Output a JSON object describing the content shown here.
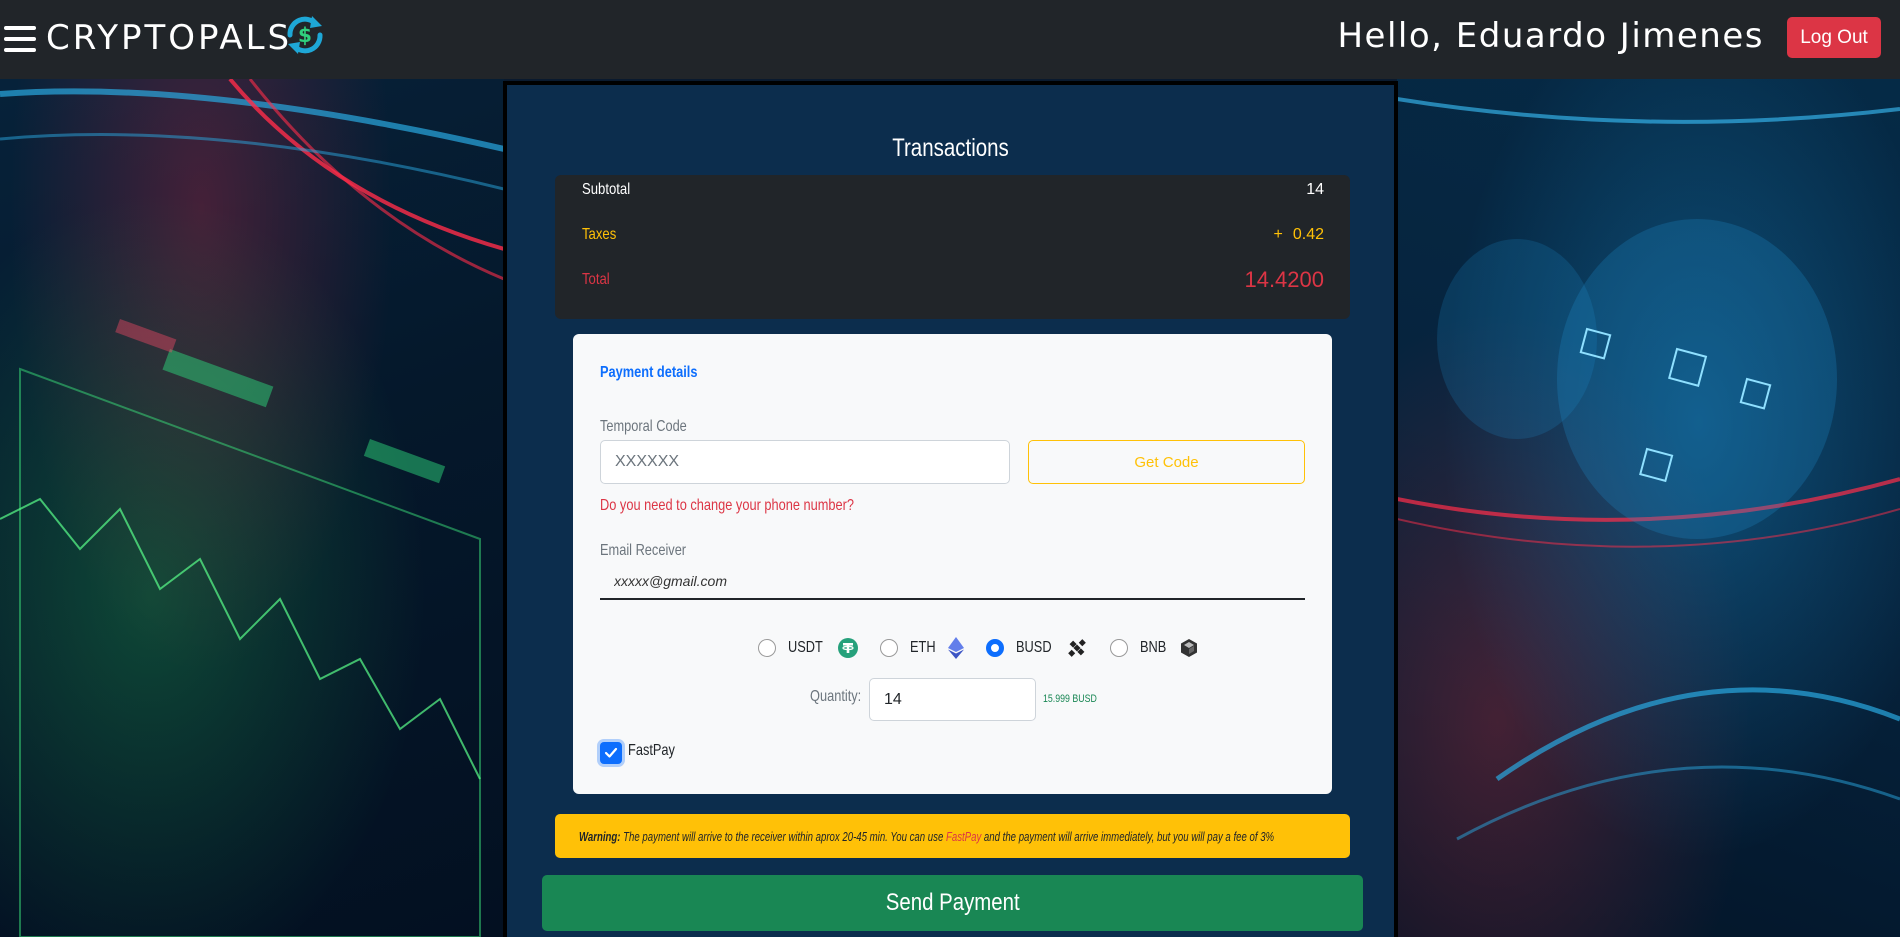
{
  "header": {
    "brand": "CRYPTOPALS",
    "greeting": "Hello, Eduardo Jimenes",
    "logout_label": "Log Out"
  },
  "transactions": {
    "title": "Transactions",
    "subtotal_label": "Subtotal",
    "subtotal_value": "14",
    "taxes_label": "Taxes",
    "taxes_sign": "+",
    "taxes_value": "0.42",
    "total_label": "Total",
    "total_value": "14.4200"
  },
  "payment": {
    "title": "Payment details",
    "code_label": "Temporal Code",
    "code_placeholder": "XXXXXX",
    "get_code_label": "Get Code",
    "phone_link": "Do you need to change your phone number?",
    "email_label": "Email Receiver",
    "email_placeholder": "xxxxx@gmail.com",
    "coins": [
      {
        "label": "USDT",
        "icon": "tether-icon",
        "selected": false
      },
      {
        "label": "ETH",
        "icon": "ethereum-icon",
        "selected": false
      },
      {
        "label": "BUSD",
        "icon": "busd-icon",
        "selected": true
      },
      {
        "label": "BNB",
        "icon": "bnb-icon",
        "selected": false
      }
    ],
    "quantity_label": "Quantity:",
    "quantity_value": "14",
    "quantity_hint": "15.999 BUSD",
    "fastpay_label": "FastPay",
    "fastpay_checked": true
  },
  "warning": {
    "prefix": "Warning:",
    "text1": " The payment will arrive to the receiver within aprox 20-45 min. You can use ",
    "highlight": "FastPay",
    "text2": " and the payment will arrive immediately, but you will pay a fee of 3%"
  },
  "send_label": "Send Payment",
  "colors": {
    "header": "#212529",
    "panel": "#0c2d4d",
    "danger": "#dc3545",
    "warning": "#ffc107",
    "primary": "#0d6efd",
    "success": "#198754"
  }
}
